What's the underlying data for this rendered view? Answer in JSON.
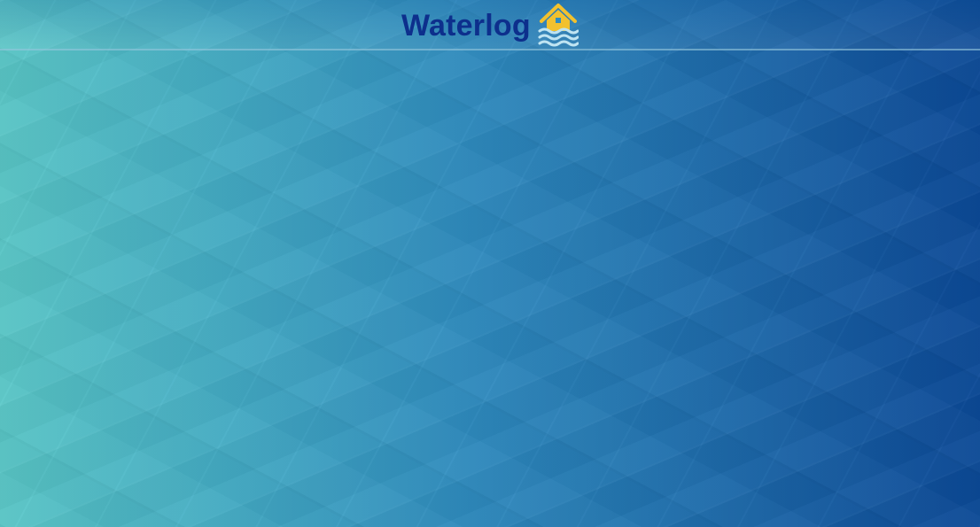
{
  "app": {
    "title": "Waterlog",
    "logo_icon": "flooded-house-icon"
  },
  "colors": {
    "brand_text": "#0d2f8c",
    "icon_house": "#f2c12e",
    "icon_waves": "#bfe4f2",
    "background_left": "#5ac8c8",
    "background_right": "#0b4a98"
  }
}
